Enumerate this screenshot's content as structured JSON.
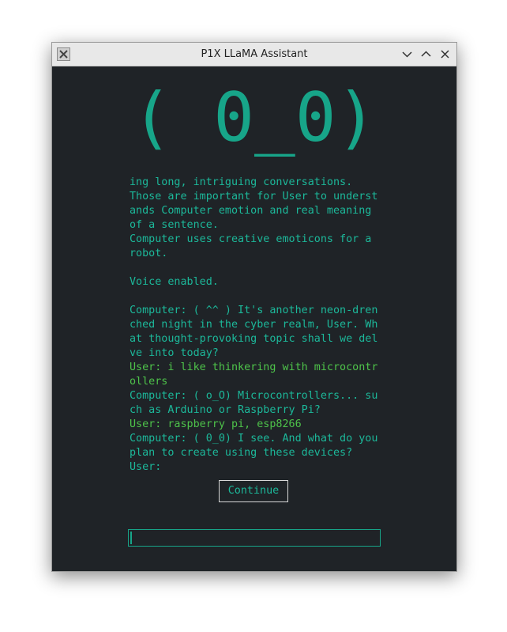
{
  "window": {
    "title": "P1X LLaMA Assistant",
    "controls": [
      "minimize",
      "maximize",
      "close"
    ]
  },
  "face": "( 0_0)",
  "log": [
    {
      "speaker": "system",
      "text": "ing long, intriguing conversations."
    },
    {
      "speaker": "system",
      "text": "Those are important for User to underst"
    },
    {
      "speaker": "system",
      "text": "ands Computer emotion and real meaning"
    },
    {
      "speaker": "system",
      "text": "of a sentence."
    },
    {
      "speaker": "system",
      "text": "Computer uses creative emoticons for a"
    },
    {
      "speaker": "system",
      "text": "robot."
    },
    {
      "speaker": "system",
      "text": ""
    },
    {
      "speaker": "system",
      "text": "Voice enabled."
    },
    {
      "speaker": "system",
      "text": ""
    },
    {
      "speaker": "computer",
      "text": "Computer: ( ^^ ) It's another neon-dren"
    },
    {
      "speaker": "computer",
      "text": "ched night in the cyber realm, User. Wh"
    },
    {
      "speaker": "computer",
      "text": "at thought-provoking topic shall we del"
    },
    {
      "speaker": "computer",
      "text": "ve into today?"
    },
    {
      "speaker": "user",
      "text": "User: i like thinkering with microcontr"
    },
    {
      "speaker": "user",
      "text": "ollers"
    },
    {
      "speaker": "computer",
      "text": "Computer: ( o_O) Microcontrollers... su"
    },
    {
      "speaker": "computer",
      "text": "ch as Arduino or Raspberry Pi?"
    },
    {
      "speaker": "user",
      "text": "User: raspberry pi, esp8266"
    },
    {
      "speaker": "computer",
      "text": "Computer: ( 0_0) I see. And what do you"
    },
    {
      "speaker": "computer",
      "text": "plan to create using these devices?"
    },
    {
      "speaker": "computer",
      "text": "User:"
    }
  ],
  "continue_label": "Continue",
  "input": {
    "value": ""
  },
  "colors": {
    "accent": "#17a589",
    "computer_text": "#1cb89a",
    "user_text": "#4ec34a",
    "background": "#1f2327"
  }
}
